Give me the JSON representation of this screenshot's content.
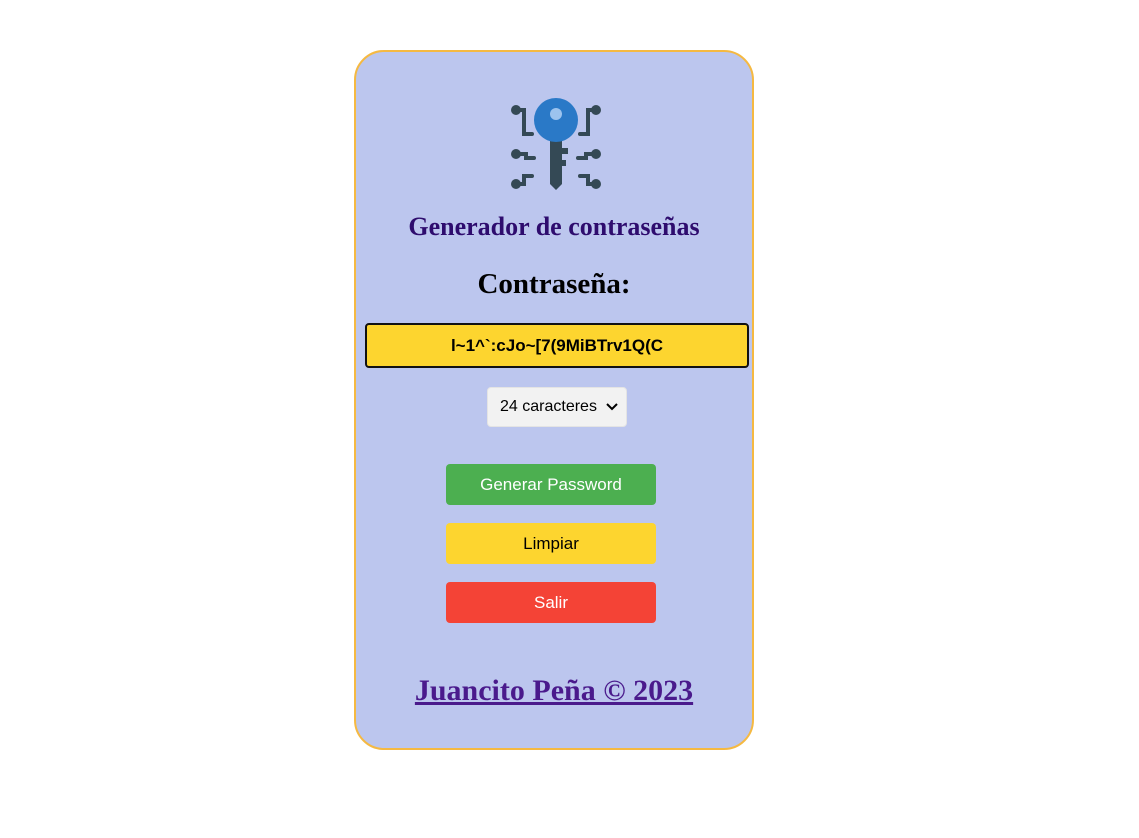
{
  "app": {
    "title": "Generador de contraseñas",
    "password_heading": "Contraseña:"
  },
  "password": {
    "value": "l~1^`:cJo~[7(9MiBTrv1Q(C"
  },
  "length_select": {
    "selected": "24 caracteres"
  },
  "buttons": {
    "generate_label": "Generar Password",
    "clear_label": "Limpiar",
    "exit_label": "Salir"
  },
  "footer": {
    "link_text": "Juancito Peña © 2023"
  },
  "colors": {
    "card_background": "#bcc6ee",
    "card_border": "#f5b942",
    "password_background": "#fdd52f",
    "generate": "#4caf50",
    "clear": "#fdd52f",
    "exit": "#f44336",
    "title": "#2e0c6e",
    "footer_link": "#4a1a8c"
  },
  "icons": {
    "logo": "digital-key-icon",
    "select_chevron": "chevron-down-icon"
  }
}
